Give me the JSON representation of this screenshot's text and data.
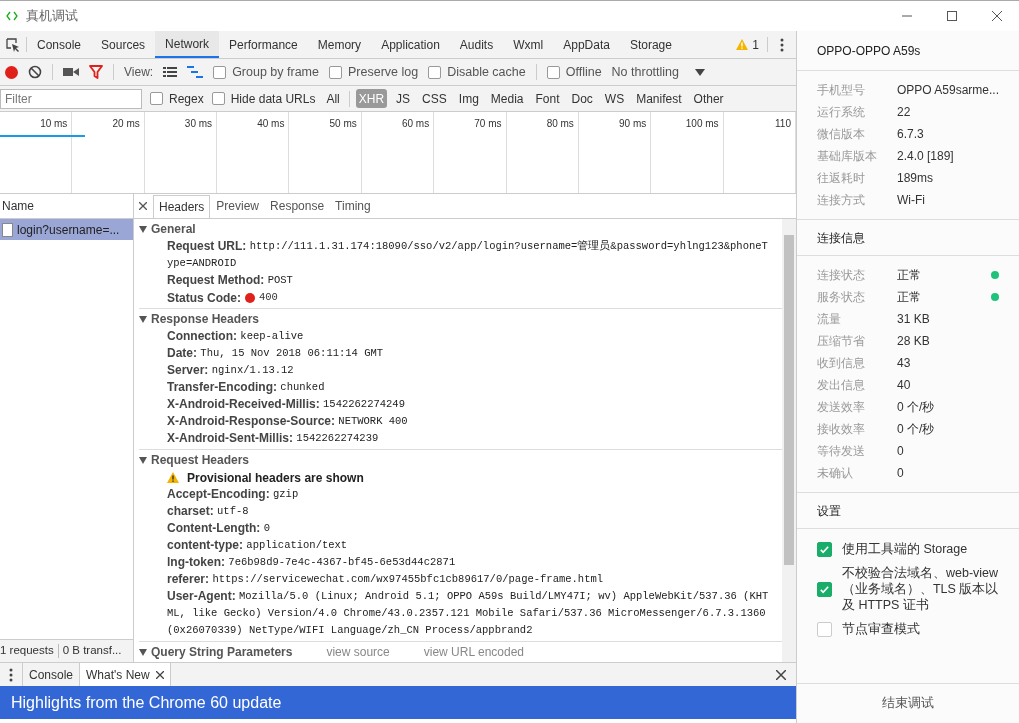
{
  "window": {
    "title": "真机调试"
  },
  "devtools": {
    "tabs": [
      {
        "label": "Console",
        "selected": false
      },
      {
        "label": "Sources",
        "selected": false
      },
      {
        "label": "Network",
        "selected": true
      },
      {
        "label": "Performance",
        "selected": false
      },
      {
        "label": "Memory",
        "selected": false
      },
      {
        "label": "Application",
        "selected": false
      },
      {
        "label": "Audits",
        "selected": false
      },
      {
        "label": "Wxml",
        "selected": false
      },
      {
        "label": "AppData",
        "selected": false
      },
      {
        "label": "Storage",
        "selected": false
      }
    ],
    "warning_count": "1"
  },
  "toolbar": {
    "recording": true,
    "view_label": "View:",
    "checkboxes": [
      {
        "label": "Group by frame",
        "checked": false
      },
      {
        "label": "Preserve log",
        "checked": false
      },
      {
        "label": "Disable cache",
        "checked": false
      },
      {
        "label": "Offline",
        "checked": false
      }
    ],
    "throttling": "No throttling"
  },
  "filter": {
    "placeholder": "Filter",
    "checkboxes": [
      {
        "label": "Regex",
        "checked": false
      },
      {
        "label": "Hide data URLs",
        "checked": false
      }
    ],
    "types": [
      {
        "label": "All",
        "selected": false
      },
      {
        "label": "XHR",
        "selected": true
      },
      {
        "label": "JS",
        "selected": false
      },
      {
        "label": "CSS",
        "selected": false
      },
      {
        "label": "Img",
        "selected": false
      },
      {
        "label": "Media",
        "selected": false
      },
      {
        "label": "Font",
        "selected": false
      },
      {
        "label": "Doc",
        "selected": false
      },
      {
        "label": "WS",
        "selected": false
      },
      {
        "label": "Manifest",
        "selected": false
      },
      {
        "label": "Other",
        "selected": false
      }
    ]
  },
  "timeline": {
    "ticks": [
      "10 ms",
      "20 ms",
      "30 ms",
      "40 ms",
      "50 ms",
      "60 ms",
      "70 ms",
      "80 ms",
      "90 ms",
      "100 ms",
      "110"
    ]
  },
  "requests": {
    "column": "Name",
    "rows": [
      {
        "name": "login?username=...",
        "selected": true
      }
    ],
    "summary": [
      "1 requests",
      "0 B transf..."
    ]
  },
  "details": {
    "tabs": [
      {
        "label": "Headers",
        "selected": true
      },
      {
        "label": "Preview",
        "selected": false
      },
      {
        "label": "Response",
        "selected": false
      },
      {
        "label": "Timing",
        "selected": false
      }
    ],
    "sections": [
      {
        "title": "General",
        "expanded": true,
        "rows": [
          {
            "kind": "field",
            "key": "Request URL:",
            "value": "http://111.1.31.174:18090/sso/v2/app/login?username=管理员&password=yhlng123&phoneType=ANDROID"
          },
          {
            "kind": "field",
            "key": "Request Method:",
            "value": "POST"
          },
          {
            "kind": "status",
            "key": "Status Code:",
            "value": "400"
          }
        ]
      },
      {
        "title": "Response Headers",
        "expanded": true,
        "rows": [
          {
            "kind": "field",
            "key": "Connection:",
            "value": "keep-alive"
          },
          {
            "kind": "field",
            "key": "Date:",
            "value": "Thu, 15 Nov 2018 06:11:14 GMT"
          },
          {
            "kind": "field",
            "key": "Server:",
            "value": "nginx/1.13.12"
          },
          {
            "kind": "field",
            "key": "Transfer-Encoding:",
            "value": "chunked"
          },
          {
            "kind": "field",
            "key": "X-Android-Received-Millis:",
            "value": "1542262274249"
          },
          {
            "kind": "field",
            "key": "X-Android-Response-Source:",
            "value": "NETWORK 400"
          },
          {
            "kind": "field",
            "key": "X-Android-Sent-Millis:",
            "value": "1542262274239"
          }
        ]
      },
      {
        "title": "Request Headers",
        "expanded": true,
        "rows": [
          {
            "kind": "warning",
            "key": "Provisional headers are shown"
          },
          {
            "kind": "field",
            "key": "Accept-Encoding:",
            "value": "gzip"
          },
          {
            "kind": "field",
            "key": "charset:",
            "value": "utf-8"
          },
          {
            "kind": "field",
            "key": "Content-Length:",
            "value": "0"
          },
          {
            "kind": "field",
            "key": "content-type:",
            "value": "application/text"
          },
          {
            "kind": "field",
            "key": "lng-token:",
            "value": "7e6b98d9-7e4c-4367-bf45-6e53d44c2871"
          },
          {
            "kind": "field",
            "key": "referer:",
            "value": "https://servicewechat.com/wx97455bfc1cb89617/0/page-frame.html"
          },
          {
            "kind": "field",
            "key": "User-Agent:",
            "value": "Mozilla/5.0 (Linux; Android 5.1; OPPO A59s Build/LMY47I; wv) AppleWebKit/537.36 (KHTML, like Gecko) Version/4.0 Chrome/43.0.2357.121 Mobile Safari/537.36 MicroMessenger/6.7.3.1360(0x26070339) NetType/WIFI Language/zh_CN Process/appbrand2"
          }
        ]
      },
      {
        "title": "Query String Parameters",
        "expanded": true,
        "links": [
          "view source",
          "view URL encoded"
        ]
      }
    ]
  },
  "drawer": {
    "tabs": [
      {
        "label": "Console",
        "selected": false,
        "closable": false
      },
      {
        "label": "What's New",
        "selected": true,
        "closable": true
      }
    ],
    "banner": "Highlights from the Chrome 60 update"
  },
  "panel": {
    "device": "OPPO-OPPO A59s",
    "info": [
      {
        "label": "手机型号",
        "value": "OPPO A59sarme..."
      },
      {
        "label": "运行系统",
        "value": "22"
      },
      {
        "label": "微信版本",
        "value": "6.7.3"
      },
      {
        "label": "基础库版本",
        "value": "2.4.0 [189]"
      },
      {
        "label": "往返耗时",
        "value": "189ms"
      },
      {
        "label": "连接方式",
        "value": "Wi-Fi"
      }
    ],
    "connection_title": "连接信息",
    "connection": [
      {
        "label": "连接状态",
        "value": "正常",
        "color": "#1ec27a"
      },
      {
        "label": "服务状态",
        "value": "正常",
        "color": "#1ec27a"
      },
      {
        "label": "流量",
        "value": "31 KB"
      },
      {
        "label": "压缩节省",
        "value": "28 KB"
      },
      {
        "label": "收到信息",
        "value": "43"
      },
      {
        "label": "发出信息",
        "value": "40"
      },
      {
        "label": "发送效率",
        "value": "0 个/秒"
      },
      {
        "label": "接收效率",
        "value": "0 个/秒"
      },
      {
        "label": "等待发送",
        "value": "0"
      },
      {
        "label": "未确认",
        "value": "0"
      }
    ],
    "settings_title": "设置",
    "settings": [
      {
        "label": "使用工具端的 Storage",
        "checked": true
      },
      {
        "label": "不校验合法域名、web-view（业务域名）、TLS 版本以及 HTTPS 证书",
        "checked": true
      },
      {
        "label": "节点审查模式",
        "checked": false
      }
    ],
    "end_button": "结束调试"
  }
}
